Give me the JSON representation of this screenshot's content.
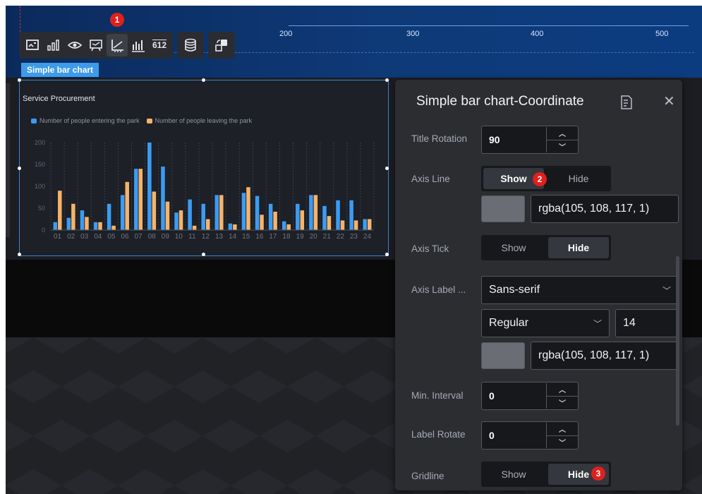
{
  "top_axis": {
    "ticks": [
      "200",
      "300",
      "400",
      "500"
    ]
  },
  "toolbar": {
    "icons": [
      "image-icon",
      "bar-chart-icon",
      "eye-icon",
      "comment-icon",
      "axis-icon",
      "series-icon",
      "number-612-icon",
      "database-icon",
      "interaction-icon"
    ],
    "number_label": "612",
    "badge_1": "1"
  },
  "component_tag": "Simple bar chart",
  "chart": {
    "title": "Service Procurement",
    "legend_entering": "Number of people entering the park",
    "legend_leaving": "Number of people leaving the park"
  },
  "colors": {
    "series_entering": "#3b9cf3",
    "series_leaving": "#f6b36a",
    "accent": "#3d9be9",
    "badge": "#e0201d"
  },
  "chart_data": {
    "type": "bar",
    "title": "Service Procurement",
    "categories": [
      "01",
      "02",
      "03",
      "04",
      "05",
      "06",
      "07",
      "08",
      "09",
      "10",
      "11",
      "12",
      "13",
      "14",
      "15",
      "16",
      "17",
      "18",
      "19",
      "20",
      "21",
      "22",
      "23",
      "24"
    ],
    "series": [
      {
        "name": "Number of people entering the park",
        "values": [
          18,
          28,
          45,
          18,
          60,
          80,
          140,
          200,
          145,
          40,
          70,
          60,
          80,
          15,
          85,
          78,
          60,
          20,
          60,
          80,
          55,
          68,
          68,
          25
        ]
      },
      {
        "name": "Number of people leaving the park",
        "values": [
          90,
          60,
          30,
          18,
          10,
          110,
          140,
          88,
          65,
          45,
          10,
          25,
          80,
          13,
          98,
          35,
          42,
          13,
          45,
          80,
          32,
          22,
          22,
          25
        ]
      }
    ],
    "ylim": [
      0,
      200
    ],
    "yticks": [
      "0",
      "50",
      "100",
      "150",
      "200"
    ],
    "grid": true
  },
  "panel": {
    "title": "Simple bar chart-Coordinate",
    "title_rotation_label": "Title Rotation",
    "title_rotation_value": "90",
    "axis_line_label": "Axis Line",
    "axis_line_show": "Show",
    "axis_line_hide": "Hide",
    "axis_line_color": "rgba(105, 108, 117, 1)",
    "axis_tick_label": "Axis Tick",
    "axis_tick_show": "Show",
    "axis_tick_hide": "Hide",
    "axis_label_label": "Axis Label ...",
    "font_family": "Sans-serif",
    "font_weight": "Regular",
    "font_size": "14",
    "axis_label_color": "rgba(105, 108, 117, 1)",
    "min_interval_label": "Min. Interval",
    "min_interval_value": "0",
    "label_rotate_label": "Label Rotate",
    "label_rotate_value": "0",
    "gridline_label": "Gridline",
    "gridline_show": "Show",
    "gridline_hide": "Hide",
    "badge_2": "2",
    "badge_3": "3"
  }
}
